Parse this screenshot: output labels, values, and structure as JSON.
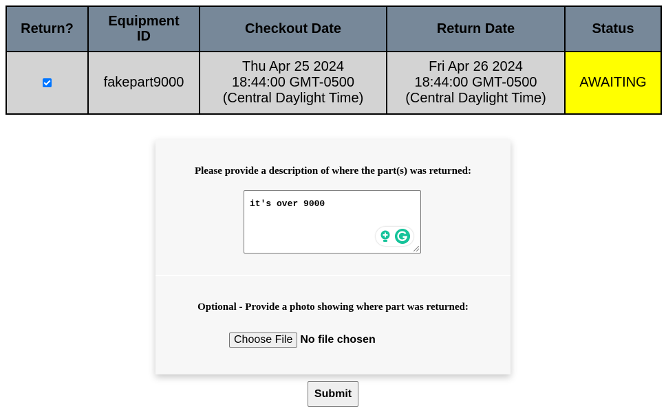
{
  "table": {
    "headers": {
      "return": "Return?",
      "equipment_id_line1": "Equipment",
      "equipment_id_line2": "ID",
      "checkout_date": "Checkout Date",
      "return_date": "Return Date",
      "status": "Status"
    },
    "rows": [
      {
        "return_checked": true,
        "equipment_id": "fakepart9000",
        "checkout_line1": "Thu Apr 25 2024",
        "checkout_line2": "18:44:00 GMT-0500",
        "checkout_line3": "(Central Daylight Time)",
        "return_line1": "Fri Apr 26 2024",
        "return_line2": "18:44:00 GMT-0500",
        "return_line3": "(Central Daylight Time)",
        "status": "AWAITING",
        "status_color": "#ffff00"
      }
    ],
    "header_color": "#778899",
    "row_color": "#d3d3d3"
  },
  "form": {
    "description_label": "Please provide a description of where the part(s) was returned:",
    "description_value": "it's over 9000",
    "photo_label": "Optional - Provide a photo showing where part was returned:",
    "choose_file_label": "Choose File",
    "no_file_text": "No file chosen",
    "submit_label": "Submit",
    "grammarly_icons": [
      "lightbulb-icon",
      "grammarly-icon"
    ]
  }
}
